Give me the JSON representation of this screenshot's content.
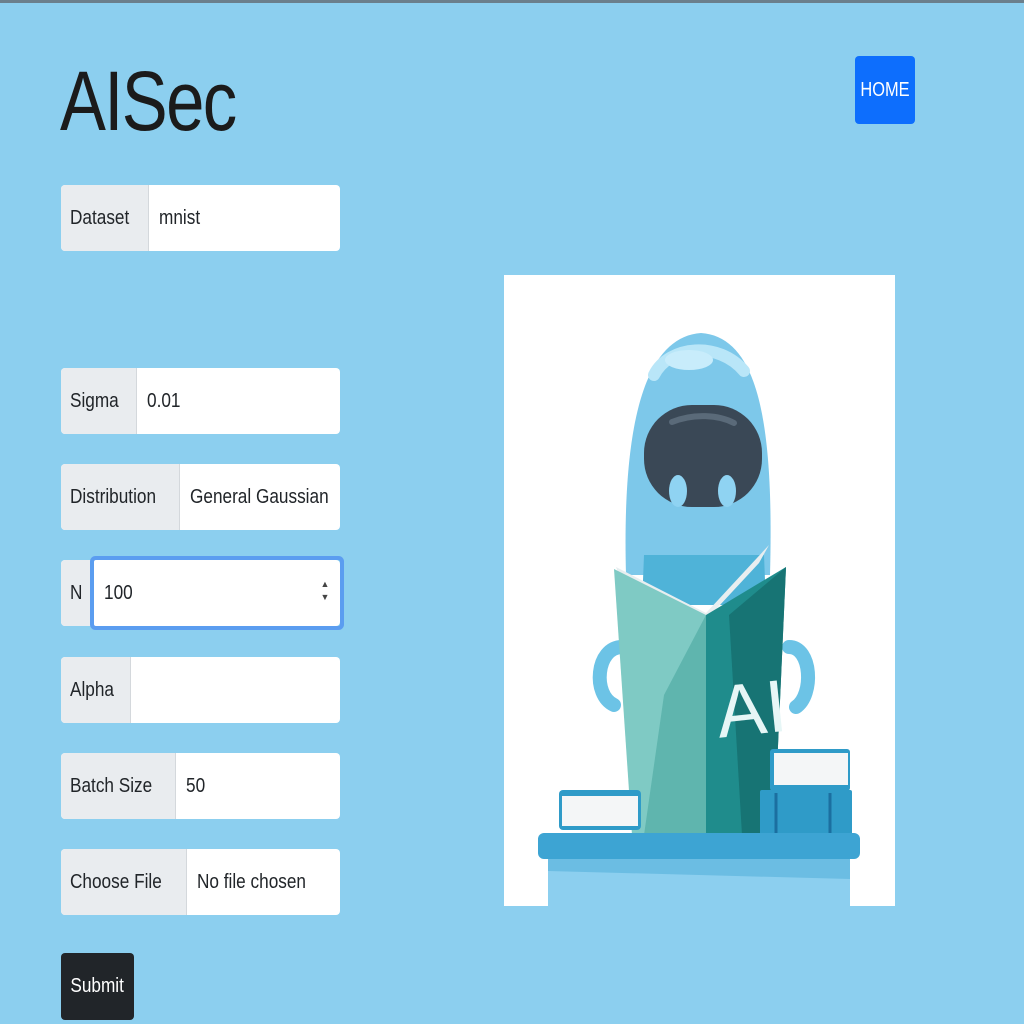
{
  "header": {
    "brand": "AISec",
    "home_label": "HOME"
  },
  "form": {
    "dataset": {
      "label": "Dataset",
      "value": "mnist"
    },
    "sigma": {
      "label": "Sigma",
      "value": "0.01"
    },
    "distribution": {
      "label": "Distribution",
      "value": "General Gaussian"
    },
    "n": {
      "label": "N",
      "value": "100"
    },
    "alpha": {
      "label": "Alpha",
      "value": ""
    },
    "batch_size": {
      "label": "Batch Size",
      "value": "50"
    },
    "file": {
      "label": "Choose File",
      "value": "No file chosen"
    },
    "submit_label": "Submit"
  },
  "illustration": {
    "book_text": "AI",
    "colors": {
      "page_bg": "#8ccfef",
      "primary": "#0d6efd",
      "dark": "#212529",
      "robot": "#7dc8ea"
    }
  }
}
